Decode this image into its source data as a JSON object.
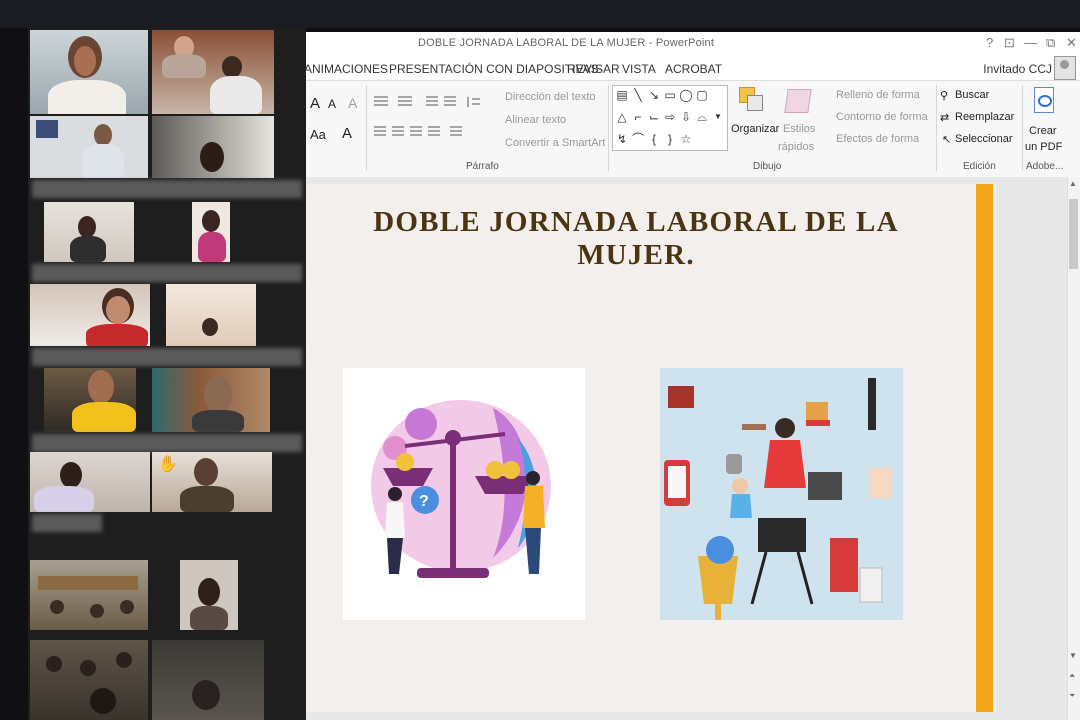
{
  "window": {
    "title": "DOBLE JORNADA LABORAL DE LA MUJER - PowerPoint"
  },
  "window_controls": {
    "help": "?",
    "ribbon_display": "⊡",
    "minimize": "—",
    "restore": "⧉",
    "close": "✕"
  },
  "menu": {
    "tabs": [
      "ANIMACIONES",
      "PRESENTACIÓN CON DIAPOSITIVAS",
      "REVISAR",
      "VISTA",
      "ACROBAT"
    ],
    "user": "Invitado CCJ"
  },
  "ribbon": {
    "font_group": {
      "grow": "A",
      "shrink": "A",
      "clear": "A",
      "size_label": "Aa",
      "color": "A"
    },
    "paragraph": {
      "label": "Párrafo",
      "text_direction": "Dirección del texto",
      "align_text": "Alinear texto",
      "smartart": "Convertir a SmartArt"
    },
    "drawing": {
      "label": "Dibujo",
      "arrange": "Organizar",
      "quick_styles_1": "Estilos",
      "quick_styles_2": "rápidos",
      "shape_fill": "Relleno de forma",
      "shape_outline": "Contorno de forma",
      "shape_effects": "Efectos de forma"
    },
    "editing": {
      "label": "Edición",
      "find": "Buscar",
      "replace": "Reemplazar",
      "select": "Seleccionar"
    },
    "adobe": {
      "label": "Adobe...",
      "create_1": "Crear",
      "create_2": "un PDF"
    }
  },
  "slide": {
    "title": "DOBLE JORNADA LABORAL DE LA MUJER."
  },
  "colors": {
    "accent_bar": "#f2a71b",
    "title_color": "#4a3411",
    "selected_tile": "#2fa84f"
  },
  "icons": {
    "raise_hand": "raised-hand-icon"
  }
}
